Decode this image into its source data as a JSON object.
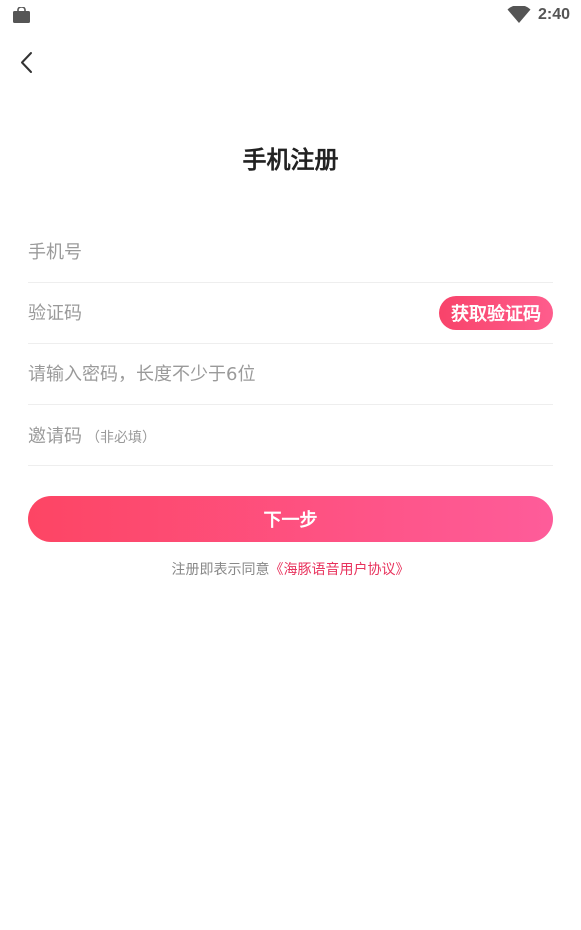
{
  "status_bar": {
    "time": "2:40",
    "left_icon": "shopping-bag-icon",
    "right_icon": "wifi-icon"
  },
  "nav": {
    "back_icon": "chevron-left-icon"
  },
  "page": {
    "title": "手机注册"
  },
  "form": {
    "phone_placeholder": "手机号",
    "code_placeholder": "验证码",
    "get_code_label": "获取验证码",
    "password_placeholder": "请输入密码，长度不少于6位",
    "invite_label": "邀请码",
    "invite_hint": "（非必填）"
  },
  "actions": {
    "next_label": "下一步"
  },
  "agreement": {
    "prefix": "注册即表示同意",
    "link": "《海豚语音用户协议》"
  },
  "colors": {
    "accent_start": "#fd4564",
    "accent_end": "#fe5c9a",
    "link": "#e8335d"
  }
}
